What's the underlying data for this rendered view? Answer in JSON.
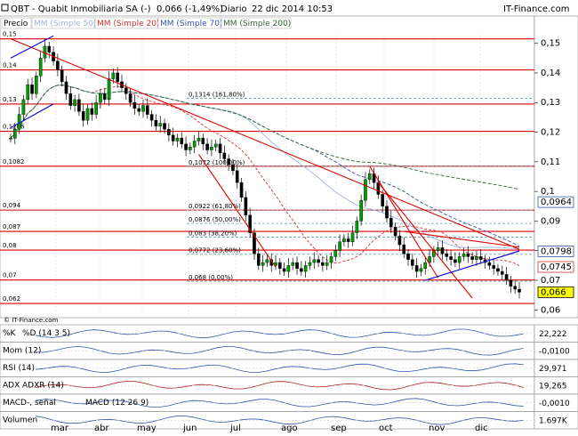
{
  "header": {
    "title": "QBT - Quabit Inmobiliaria SA (-)",
    "quote": "0,066 (-1,49%)",
    "period": "Diario",
    "timestamp": "22 dic 2014 10:53",
    "brand": "IT-Finance.com"
  },
  "legend": {
    "price": "Precio",
    "mm50": "MM (Simple 50)",
    "mm20": "MM (Simple 20)",
    "mm70": "MM (Simple 70)",
    "mm200": "MM (Simple 200)"
  },
  "watermark": "© IT-Finance.com",
  "colors": {
    "price_up": "#00a000",
    "price_down": "#000000",
    "trendline_red": "#dd0000",
    "trendline_blue": "#0000dd",
    "mm20": "#cc3333",
    "mm70": "#3355aa",
    "mm200": "#336633",
    "fib": "#5f9fb0"
  },
  "chart_data": {
    "type": "candlestick",
    "x_labels": [
      "mar",
      "abr",
      "may",
      "jun",
      "jul",
      "ago",
      "sep",
      "oct",
      "nov",
      "dic"
    ],
    "y_ticks": [
      "0,15",
      "0,14",
      "0,13",
      "0,12",
      "0,11",
      "0,1",
      "0,09",
      "0,08",
      "0,07",
      "0,06"
    ],
    "ylim": [
      0.058,
      0.158
    ],
    "right_labels": [
      {
        "text": "0,0964",
        "value": 0.0964,
        "color": "#3355aa"
      },
      {
        "text": "0,0798",
        "value": 0.0798,
        "color": "#3355aa"
      },
      {
        "text": "0,0745",
        "value": 0.0745,
        "color": "#cc3333"
      },
      {
        "text": "0,066",
        "value": 0.066,
        "color": "#000000",
        "bg": "#ffff00"
      }
    ],
    "horizontal_levels": [
      {
        "text": "0,15",
        "value": 0.1515
      },
      {
        "text": "0,14",
        "value": 0.141
      },
      {
        "text": "0,13",
        "value": 0.1295
      },
      {
        "text": "0,1206",
        "value": 0.1203
      },
      {
        "text": "0,1082",
        "value": 0.1085
      },
      {
        "text": "0,094",
        "value": 0.0937
      },
      {
        "text": "0,087",
        "value": 0.0865
      },
      {
        "text": "0,08",
        "value": 0.0802
      },
      {
        "text": "0,07",
        "value": 0.0701
      },
      {
        "text": "0,062",
        "value": 0.0622
      }
    ],
    "fibonacci": [
      {
        "text": "0,1314 (161,80%)",
        "value": 0.1314
      },
      {
        "text": "0,1072 (100,00%)",
        "value": 0.1085
      },
      {
        "text": "0,0922 (61,80%)",
        "value": 0.0937
      },
      {
        "text": "0,0876 (50,00%)",
        "value": 0.0892
      },
      {
        "text": "0,083 (38,20%)",
        "value": 0.0846
      },
      {
        "text": "0,0772 (23,60%)",
        "value": 0.0788
      },
      {
        "text": "0,068 (0,00%)",
        "value": 0.0697
      }
    ],
    "close": [
      0.118,
      0.121,
      0.126,
      0.131,
      0.136,
      0.133,
      0.139,
      0.145,
      0.149,
      0.147,
      0.144,
      0.141,
      0.137,
      0.133,
      0.129,
      0.131,
      0.127,
      0.124,
      0.128,
      0.126,
      0.13,
      0.133,
      0.131,
      0.138,
      0.14,
      0.137,
      0.135,
      0.133,
      0.13,
      0.128,
      0.127,
      0.129,
      0.126,
      0.124,
      0.122,
      0.123,
      0.121,
      0.119,
      0.117,
      0.118,
      0.116,
      0.114,
      0.115,
      0.117,
      0.118,
      0.116,
      0.114,
      0.115,
      0.116,
      0.113,
      0.111,
      0.109,
      0.107,
      0.103,
      0.098,
      0.092,
      0.086,
      0.079,
      0.075,
      0.076,
      0.077,
      0.075,
      0.076,
      0.074,
      0.073,
      0.075,
      0.076,
      0.074,
      0.073,
      0.075,
      0.076,
      0.077,
      0.076,
      0.075,
      0.076,
      0.078,
      0.08,
      0.083,
      0.084,
      0.083,
      0.086,
      0.09,
      0.097,
      0.104,
      0.106,
      0.103,
      0.099,
      0.095,
      0.091,
      0.088,
      0.085,
      0.082,
      0.079,
      0.077,
      0.075,
      0.073,
      0.074,
      0.076,
      0.078,
      0.08,
      0.081,
      0.079,
      0.078,
      0.077,
      0.076,
      0.078,
      0.079,
      0.078,
      0.077,
      0.078,
      0.077,
      0.076,
      0.075,
      0.074,
      0.073,
      0.072,
      0.07,
      0.068,
      0.067,
      0.066
    ]
  },
  "indicators": [
    {
      "label": "%K",
      "label2": "%D (14 3 5)",
      "value": "22,222"
    },
    {
      "label": "Mom (12)",
      "label2": "",
      "value": "-0,0100"
    },
    {
      "label": "RSI (14)",
      "label2": "",
      "value": "29,971"
    },
    {
      "label": "ADX",
      "label2": "ADXR (14)",
      "value": "19,265"
    },
    {
      "label": "MACD-, señal",
      "label2": "MACD (12 26 9)",
      "value": "-0,0010"
    },
    {
      "label": "Volumen",
      "label2": "",
      "value": "1.697K"
    }
  ]
}
